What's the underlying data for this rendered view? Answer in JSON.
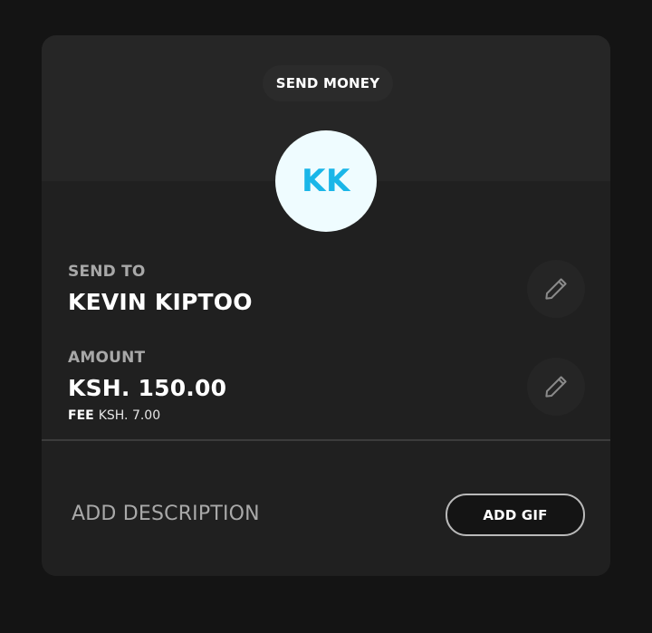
{
  "header": {
    "title": "SEND MONEY"
  },
  "recipient": {
    "initials": "KK",
    "send_to_label": "SEND TO",
    "name": "KEVIN KIPTOO"
  },
  "amount": {
    "label": "AMOUNT",
    "value": "KSH. 150.00",
    "fee_label": "FEE",
    "fee_value": "KSH. 7.00"
  },
  "footer": {
    "description_placeholder": "ADD DESCRIPTION",
    "gif_button_label": "ADD GIF"
  },
  "colors": {
    "accent": "#1ab6e8",
    "avatar_bg": "#effcff",
    "card_bg": "#202020",
    "page_bg": "#141414"
  },
  "icons": {
    "edit": "pencil-icon"
  }
}
